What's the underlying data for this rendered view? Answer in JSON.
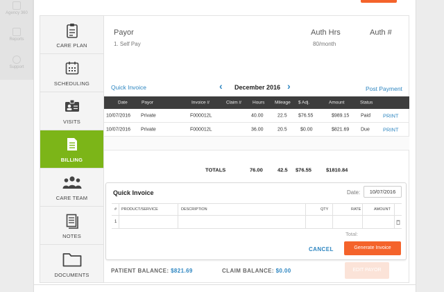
{
  "rail": {
    "items": [
      {
        "label": "Agency 360",
        "icon": "building-icon"
      },
      {
        "label": "Reports",
        "icon": "reports-icon"
      },
      {
        "label": "Support",
        "icon": "lifebuoy-icon"
      }
    ]
  },
  "nav": {
    "items": [
      {
        "label": "CARE PLAN",
        "icon": "clipboard-icon"
      },
      {
        "label": "SCHEDULING",
        "icon": "calendar-icon"
      },
      {
        "label": "VISITS",
        "icon": "id-card-icon"
      },
      {
        "label": "BILLING",
        "icon": "invoice-icon",
        "active": true
      },
      {
        "label": "CARE TEAM",
        "icon": "team-icon"
      },
      {
        "label": "NOTES",
        "icon": "notes-icon"
      },
      {
        "label": "DOCUMENTS",
        "icon": "folder-icon"
      }
    ]
  },
  "payor": {
    "header_payor": "Payor",
    "header_auth_hrs": "Auth Hrs",
    "header_auth_num": "Auth #",
    "payor_value": "1. Self Pay",
    "auth_hrs_value": "80/month"
  },
  "billing": {
    "quick_invoice_link": "Quick Invoice",
    "month": "December 2016",
    "post_payment_link": "Post Payment",
    "columns": [
      "Date",
      "Payor",
      "Invoice #",
      "Claim #",
      "Hours",
      "Mileage",
      "$ Adj.",
      "Amount",
      "Status"
    ],
    "rows": [
      {
        "date": "10/07/2016",
        "payor": "Private",
        "invoice": "F000012L",
        "claim": "",
        "hours": "40.00",
        "mileage": "22.5",
        "adj": "$76.55",
        "amount": "$989.15",
        "status": "Paid",
        "action": "PRINT"
      },
      {
        "date": "10/07/2016",
        "payor": "Private",
        "invoice": "F000012L",
        "claim": "",
        "hours": "36.00",
        "mileage": "20.5",
        "adj": "$0.00",
        "amount": "$821.69",
        "status": "Due",
        "action": "PRINT"
      }
    ],
    "totals": {
      "label": "TOTALS",
      "hours": "76.00",
      "mileage": "42.5",
      "adj": "$76.55",
      "amount": "$1810.84"
    }
  },
  "quick_invoice": {
    "title": "Quick Invoice",
    "date_label": "Date:",
    "date_value": "10/07/2016",
    "columns": [
      "#",
      "PRODUCT/SERVICE",
      "DESCRIPTION",
      "QTY",
      "RATE",
      "AMOUNT"
    ],
    "row_number": "1",
    "total_label": "Total:",
    "cancel_label": "CANCEL",
    "generate_label": "Generate Invoice"
  },
  "balances": {
    "patient_label": "PATIENT BALANCE:",
    "patient_value": "$821.69",
    "claim_label": "CLAIM BALANCE:",
    "claim_value": "$0.00",
    "edit_payor_label": "EDIT PAYOR"
  },
  "colors": {
    "accent_orange": "#f4632b",
    "billing_green": "#7cb518",
    "link_blue": "#2e86c1",
    "table_header": "#3d3d3d"
  }
}
